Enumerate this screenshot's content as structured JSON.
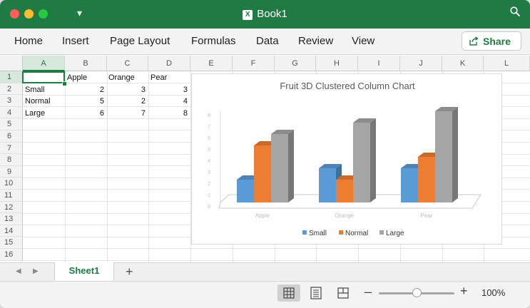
{
  "window": {
    "title": "Book1",
    "file_icon": "excel-file-icon"
  },
  "ribbon": {
    "tabs": [
      "Home",
      "Insert",
      "Page Layout",
      "Formulas",
      "Data",
      "Review",
      "View"
    ],
    "share_label": "Share"
  },
  "grid": {
    "columns": [
      "A",
      "B",
      "C",
      "D",
      "E",
      "F",
      "G",
      "H",
      "I",
      "J",
      "K",
      "L"
    ],
    "rows": [
      "1",
      "2",
      "3",
      "4",
      "5",
      "6",
      "7",
      "8",
      "9",
      "10",
      "11",
      "12",
      "13",
      "14",
      "15",
      "16"
    ],
    "selected_cell": "A1",
    "cells": [
      [
        "",
        "Apple",
        "Orange",
        "Pear"
      ],
      [
        "Small",
        "2",
        "3",
        "3"
      ],
      [
        "Normal",
        "5",
        "2",
        "4"
      ],
      [
        "Large",
        "6",
        "7",
        "8"
      ]
    ]
  },
  "sheets": {
    "tabs": [
      "Sheet1"
    ],
    "active": "Sheet1"
  },
  "status": {
    "zoom": "100%",
    "zoom_level": 1.0,
    "view_mode": "normal"
  },
  "colors": {
    "accent": "#1f7a44",
    "small": "#5b9bd5",
    "normal": "#ed7d31",
    "large": "#a5a5a5"
  },
  "chart_data": {
    "type": "bar",
    "title": "Fruit 3D Clustered Column Chart",
    "categories": [
      "Apple",
      "Orange",
      "Pear"
    ],
    "series": [
      {
        "name": "Small",
        "values": [
          2,
          3,
          3
        ],
        "color": "#5b9bd5"
      },
      {
        "name": "Normal",
        "values": [
          5,
          2,
          4
        ],
        "color": "#ed7d31"
      },
      {
        "name": "Large",
        "values": [
          6,
          7,
          8
        ],
        "color": "#a5a5a5"
      }
    ],
    "y_ticks": [
      "0",
      "1",
      "2",
      "3",
      "4",
      "5",
      "6",
      "7",
      "8"
    ],
    "ylim": [
      0,
      8
    ],
    "legend_position": "bottom",
    "three_d": true
  }
}
